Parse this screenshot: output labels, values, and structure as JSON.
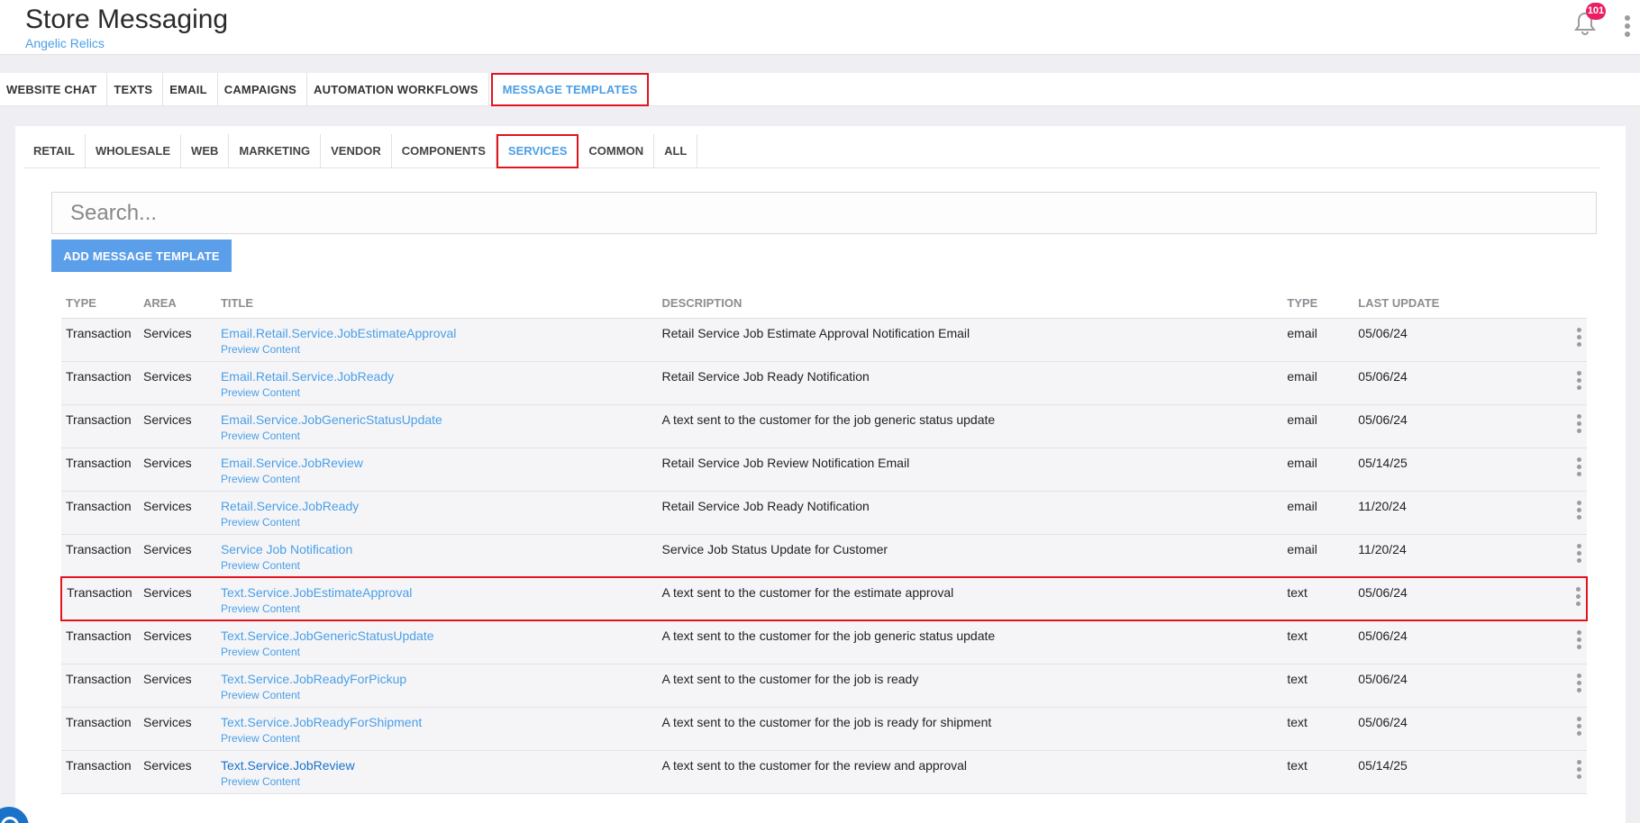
{
  "header": {
    "title": "Store Messaging",
    "store_name": "Angelic Relics",
    "notification_count": "101"
  },
  "main_tabs": [
    {
      "label": "WEBSITE CHAT"
    },
    {
      "label": "TEXTS"
    },
    {
      "label": "EMAIL"
    },
    {
      "label": "CAMPAIGNS"
    },
    {
      "label": "AUTOMATION WORKFLOWS"
    },
    {
      "label": "MESSAGE TEMPLATES",
      "active": true
    }
  ],
  "sub_tabs": [
    {
      "label": "RETAIL"
    },
    {
      "label": "WHOLESALE"
    },
    {
      "label": "WEB"
    },
    {
      "label": "MARKETING"
    },
    {
      "label": "VENDOR"
    },
    {
      "label": "COMPONENTS"
    },
    {
      "label": "SERVICES",
      "active": true
    },
    {
      "label": "COMMON"
    },
    {
      "label": "ALL"
    }
  ],
  "search": {
    "placeholder": "Search..."
  },
  "add_button_label": "ADD MESSAGE TEMPLATE",
  "table": {
    "columns": {
      "type": "TYPE",
      "area": "AREA",
      "title": "TITLE",
      "description": "DESCRIPTION",
      "channel": "TYPE",
      "last_update": "LAST UPDATE"
    },
    "preview_label": "Preview Content",
    "rows": [
      {
        "type": "Transaction",
        "area": "Services",
        "title": "Email.Retail.Service.JobEstimateApproval",
        "description": "Retail Service Job Estimate Approval Notification Email",
        "channel": "email",
        "last_update": "05/06/24"
      },
      {
        "type": "Transaction",
        "area": "Services",
        "title": "Email.Retail.Service.JobReady",
        "description": "Retail Service Job Ready Notification",
        "channel": "email",
        "last_update": "05/06/24"
      },
      {
        "type": "Transaction",
        "area": "Services",
        "title": "Email.Service.JobGenericStatusUpdate",
        "description": "A text sent to the customer for the job generic status update",
        "channel": "email",
        "last_update": "05/06/24"
      },
      {
        "type": "Transaction",
        "area": "Services",
        "title": "Email.Service.JobReview",
        "description": "Retail Service Job Review Notification Email",
        "channel": "email",
        "last_update": "05/14/25"
      },
      {
        "type": "Transaction",
        "area": "Services",
        "title": "Retail.Service.JobReady",
        "description": "Retail Service Job Ready Notification",
        "channel": "email",
        "last_update": "11/20/24"
      },
      {
        "type": "Transaction",
        "area": "Services",
        "title": "Service Job Notification",
        "description": "Service Job Status Update for Customer",
        "channel": "email",
        "last_update": "11/20/24"
      },
      {
        "type": "Transaction",
        "area": "Services",
        "title": "Text.Service.JobEstimateApproval",
        "description": "A text sent to the customer for the estimate approval",
        "channel": "text",
        "last_update": "05/06/24",
        "highlighted": true
      },
      {
        "type": "Transaction",
        "area": "Services",
        "title": "Text.Service.JobGenericStatusUpdate",
        "description": "A text sent to the customer for the job generic status update",
        "channel": "text",
        "last_update": "05/06/24"
      },
      {
        "type": "Transaction",
        "area": "Services",
        "title": "Text.Service.JobReadyForPickup",
        "description": "A text sent to the customer for the job is ready",
        "channel": "text",
        "last_update": "05/06/24"
      },
      {
        "type": "Transaction",
        "area": "Services",
        "title": "Text.Service.JobReadyForShipment",
        "description": "A text sent to the customer for the job is ready for shipment",
        "channel": "text",
        "last_update": "05/06/24"
      },
      {
        "type": "Transaction",
        "area": "Services",
        "title": "Text.Service.JobReview",
        "description": "A text sent to the customer for the review and approval",
        "channel": "text",
        "last_update": "05/14/25",
        "hovered": true
      }
    ]
  },
  "colors": {
    "accent": "#4a9fe6",
    "highlight_border": "#e3141d",
    "badge": "#e91e63",
    "button": "#5b9ee9"
  },
  "icons": {
    "notifications": "bell-icon",
    "overflow": "more-vertical-icon",
    "fab": "chat-icon"
  }
}
